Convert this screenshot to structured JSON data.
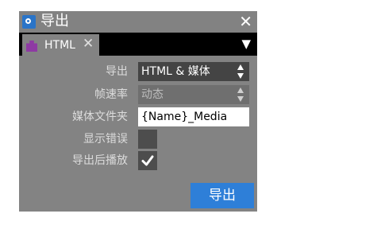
{
  "window": {
    "title": "导出",
    "close_glyph": "✕"
  },
  "tab": {
    "label": "HTML",
    "close_glyph": "✕",
    "menu_glyph": "▼"
  },
  "form": {
    "export_label": "导出",
    "export_value": "HTML & 媒体",
    "framerate_label": "帧速率",
    "framerate_value": "动态",
    "media_folder_label": "媒体文件夹",
    "media_folder_value": "{Name}_Media",
    "show_errors_label": "显示错误",
    "show_errors_checked": false,
    "play_after_label": "导出后播放",
    "play_after_checked": true
  },
  "actions": {
    "export_button": "导出"
  },
  "colors": {
    "accent": "#2e7fd8",
    "panel": "#838383",
    "tab_icon": "#8e3aa3"
  },
  "icons": {
    "app": "export-app-icon",
    "tab": "puzzle-icon",
    "check": "checkmark-icon"
  }
}
